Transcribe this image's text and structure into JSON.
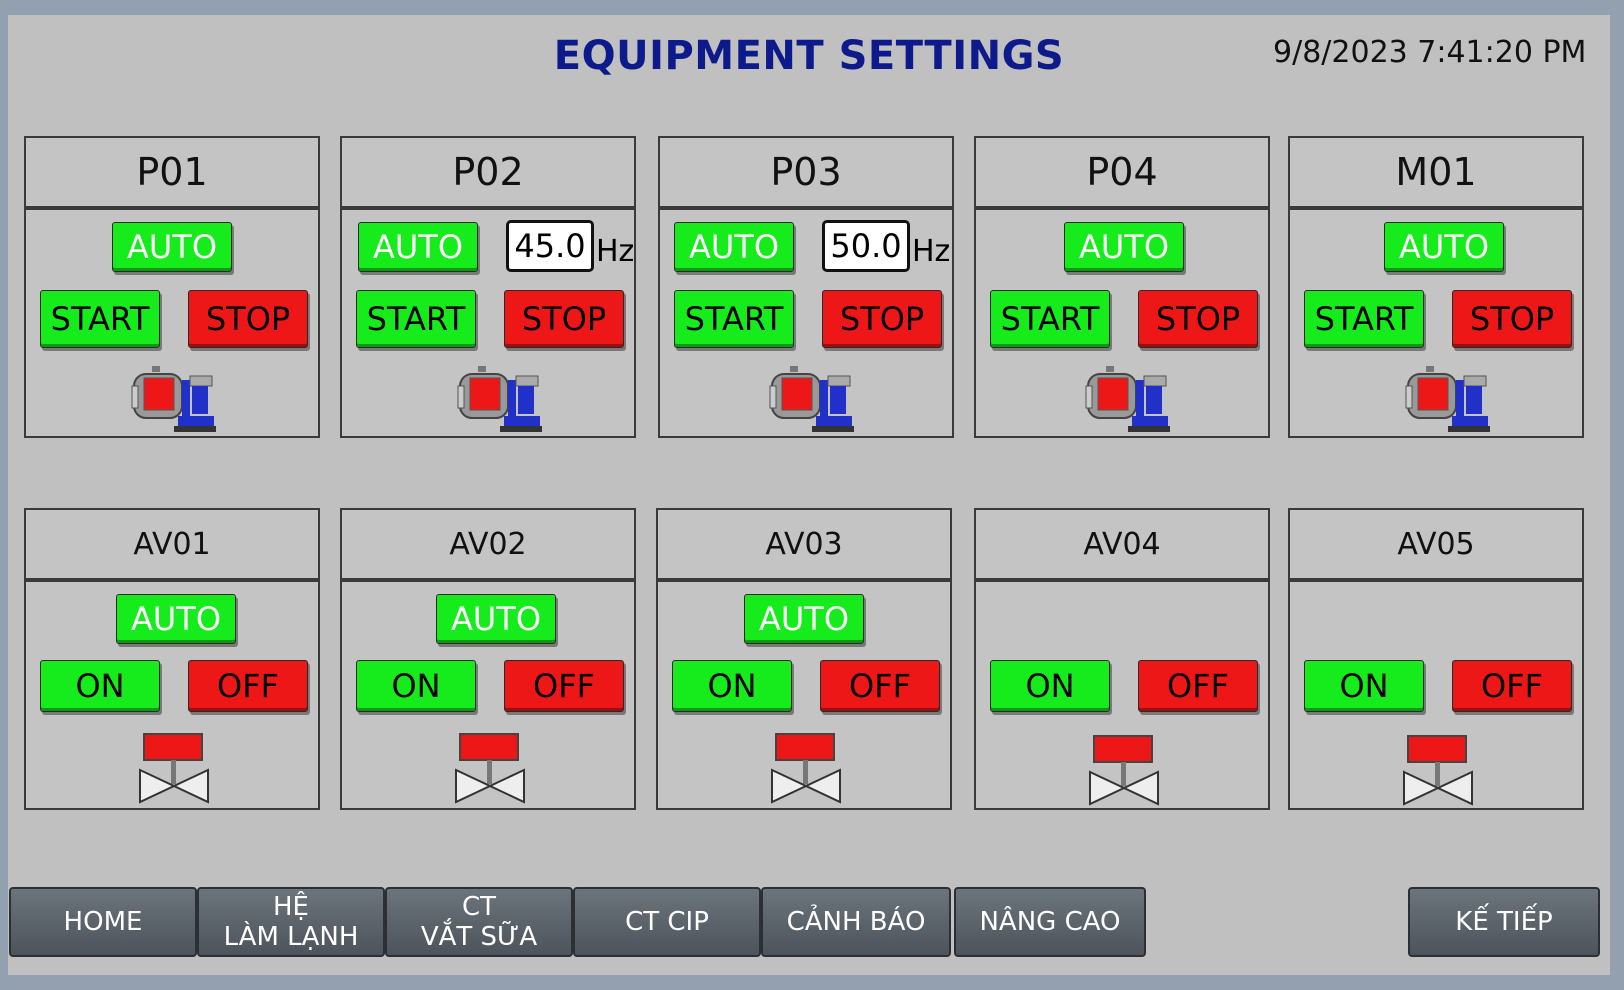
{
  "header": {
    "title": "EQUIPMENT SETTINGS",
    "datetime": "9/8/2023 7:41:20 PM"
  },
  "pumps": [
    {
      "name": "P01",
      "auto_label": "AUTO",
      "start_label": "START",
      "stop_label": "STOP"
    },
    {
      "name": "P02",
      "auto_label": "AUTO",
      "start_label": "START",
      "stop_label": "STOP",
      "frequency": "45.0",
      "unit": "Hz"
    },
    {
      "name": "P03",
      "auto_label": "AUTO",
      "start_label": "START",
      "stop_label": "STOP",
      "frequency": "50.0",
      "unit": "Hz"
    },
    {
      "name": "P04",
      "auto_label": "AUTO",
      "start_label": "START",
      "stop_label": "STOP"
    },
    {
      "name": "M01",
      "auto_label": "AUTO",
      "start_label": "START",
      "stop_label": "STOP"
    }
  ],
  "valves": [
    {
      "name": "AV01",
      "auto_label": "AUTO",
      "on_label": "ON",
      "off_label": "OFF"
    },
    {
      "name": "AV02",
      "auto_label": "AUTO",
      "on_label": "ON",
      "off_label": "OFF"
    },
    {
      "name": "AV03",
      "auto_label": "AUTO",
      "on_label": "ON",
      "off_label": "OFF"
    },
    {
      "name": "AV04",
      "on_label": "ON",
      "off_label": "OFF"
    },
    {
      "name": "AV05",
      "on_label": "ON",
      "off_label": "OFF"
    }
  ],
  "nav": {
    "home": "HOME",
    "he_lam_lanh_1": "HỆ",
    "he_lam_lanh_2": "LÀM LẠNH",
    "ct_vat_sua_1": "CT",
    "ct_vat_sua_2": "VẮT SỮA",
    "ct_cip": "CT CIP",
    "canh_bao": "CẢNH BÁO",
    "nang_cao": "NÂNG CAO",
    "ke_tiep": "KẾ TIẾP"
  },
  "colors": {
    "run_green": "#16ec1c",
    "stop_red": "#ee1717",
    "title_blue": "#0c1a8c",
    "panel_bg": "#c4c4c4"
  },
  "icons": [
    "pump-icon",
    "valve-icon"
  ]
}
